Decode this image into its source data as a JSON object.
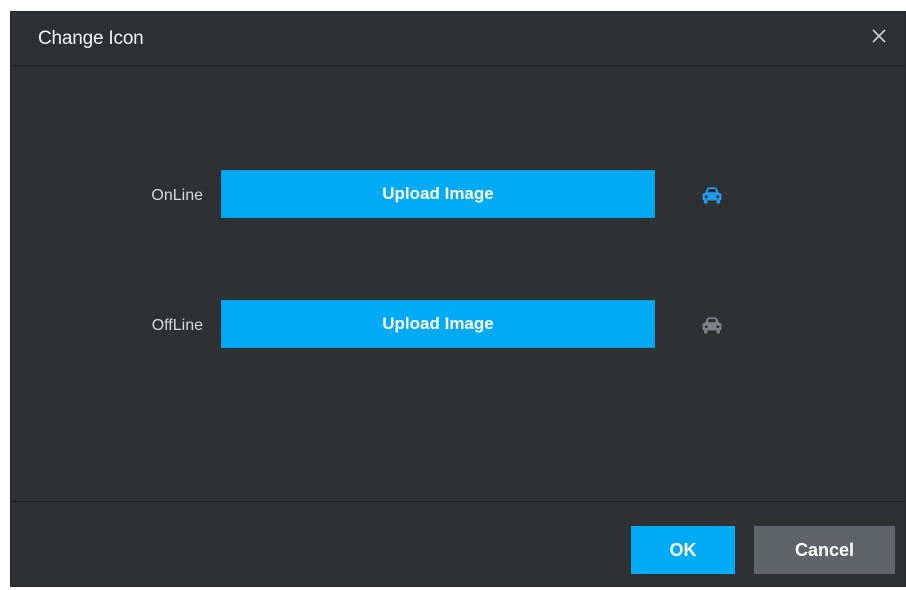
{
  "dialog": {
    "title": "Change Icon",
    "close_icon": "close-icon"
  },
  "rows": [
    {
      "label": "OnLine",
      "button_label": "Upload Image",
      "icon": "car-icon",
      "icon_color": "#1e9be6"
    },
    {
      "label": "OffLine",
      "button_label": "Upload Image",
      "icon": "car-icon",
      "icon_color": "#7c7f85"
    }
  ],
  "footer": {
    "ok_label": "OK",
    "cancel_label": "Cancel"
  },
  "colors": {
    "accent": "#00aaf5",
    "dialog_bg": "#2f3034",
    "cancel_bg": "#5f636a"
  }
}
